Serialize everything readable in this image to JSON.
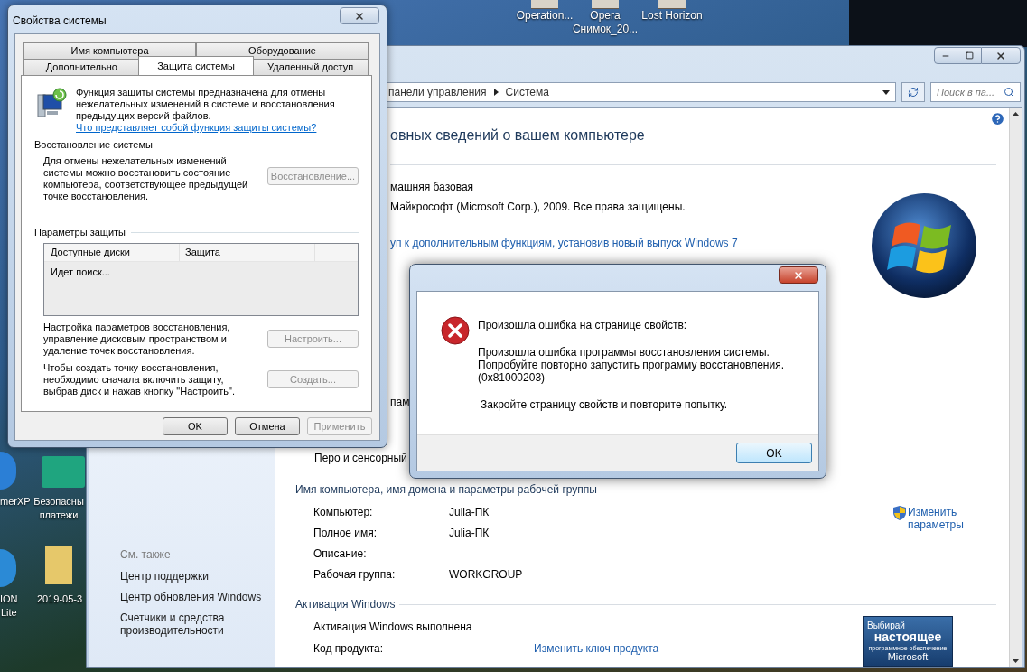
{
  "desktop": {
    "top_icons": [
      {
        "lines": [
          "Operation..."
        ]
      },
      {
        "lines": [
          "Opera",
          "Снимок_20..."
        ]
      },
      {
        "lines": [
          "Lost Horizon"
        ]
      }
    ],
    "left_icons": [
      {
        "lines": [
          "merXP"
        ]
      },
      {
        "lines": [
          "Безопасны",
          "платежи"
        ]
      },
      {
        "lines": [
          "ION",
          "Lite"
        ]
      },
      {
        "lines": [
          "2019-05-3"
        ]
      }
    ]
  },
  "control_panel": {
    "address": {
      "crumbs": [
        "панели управления",
        "Система"
      ]
    },
    "search": {
      "placeholder": "Поиск в па..."
    },
    "heading": "овных сведений о вашем компьютере",
    "edition": "машняя базовая",
    "copyright": "Майкрософт (Microsoft Corp.), 2009. Все права защищены.",
    "upgrade_link": "уп к дополнительным функциям, установив новый выпуск Windows 7",
    "partial_text": "пам",
    "pen_row": "Перо и сенсорный",
    "computer_section": {
      "title": "Имя компьютера, имя домена и параметры рабочей группы",
      "rows": [
        {
          "label": "Компьютер:",
          "value": "Julia-ПК"
        },
        {
          "label": "Полное имя:",
          "value": "Julia-ПК"
        },
        {
          "label": "Описание:",
          "value": ""
        },
        {
          "label": "Рабочая группа:",
          "value": "WORKGROUP"
        }
      ],
      "link": "Изменить параметры"
    },
    "activation_section": {
      "title": "Активация Windows",
      "status": "Активация Windows выполнена",
      "key_label": "Код продукта:",
      "link": "Изменить ключ продукта",
      "badge": [
        "Выбирай",
        "настоящее",
        "программное обеспечение",
        "Microsoft"
      ]
    },
    "sidebar": {
      "see_also": "См. также",
      "links": [
        "Центр поддержки",
        "Центр обновления Windows",
        "Счетчики и средства производительности"
      ]
    }
  },
  "system_properties": {
    "title": "Свойства системы",
    "tab_rows": [
      [
        {
          "label": "Имя компьютера",
          "selected": false
        },
        {
          "label": "Оборудование",
          "selected": false
        }
      ],
      [
        {
          "label": "Дополнительно",
          "selected": false
        },
        {
          "label": "Защита системы",
          "selected": true
        },
        {
          "label": "Удаленный доступ",
          "selected": false
        }
      ]
    ],
    "intro": "Функция защиты системы предназначена для отмены нежелательных изменений в системе и восстановления предыдущих версий файлов.",
    "intro_link": "Что представляет собой функция защиты системы?",
    "restore": {
      "title": "Восстановление системы",
      "text": "Для отмены нежелательных изменений системы можно восстановить состояние компьютера, соответствующее предыдущей точке восстановления.",
      "button": {
        "label": "Восстановление...",
        "disabled": true
      }
    },
    "protection": {
      "title": "Параметры защиты",
      "columns": [
        "Доступные диски",
        "Защита"
      ],
      "status": "Идет поиск...",
      "actions": [
        {
          "text": "Настройка параметров восстановления, управление дисковым пространством и удаление точек восстановления.",
          "button": {
            "label": "Настроить...",
            "disabled": true
          }
        },
        {
          "text": "Чтобы создать точку восстановления, необходимо сначала включить защиту, выбрав диск и нажав кнопку \"Настроить\".",
          "button": {
            "label": "Создать...",
            "disabled": true
          }
        }
      ]
    },
    "buttons": [
      {
        "label": "OK",
        "disabled": false
      },
      {
        "label": "Отмена",
        "disabled": false
      },
      {
        "label": "Применить",
        "disabled": true
      }
    ]
  },
  "error_dialog": {
    "heading": "Произошла ошибка на странице свойств:",
    "message": "Произошла ошибка программы восстановления системы. Попробуйте повторно запустить программу восстановления. (0x81000203)",
    "hint": "Закройте страницу свойств и повторите попытку.",
    "button": "OK"
  }
}
